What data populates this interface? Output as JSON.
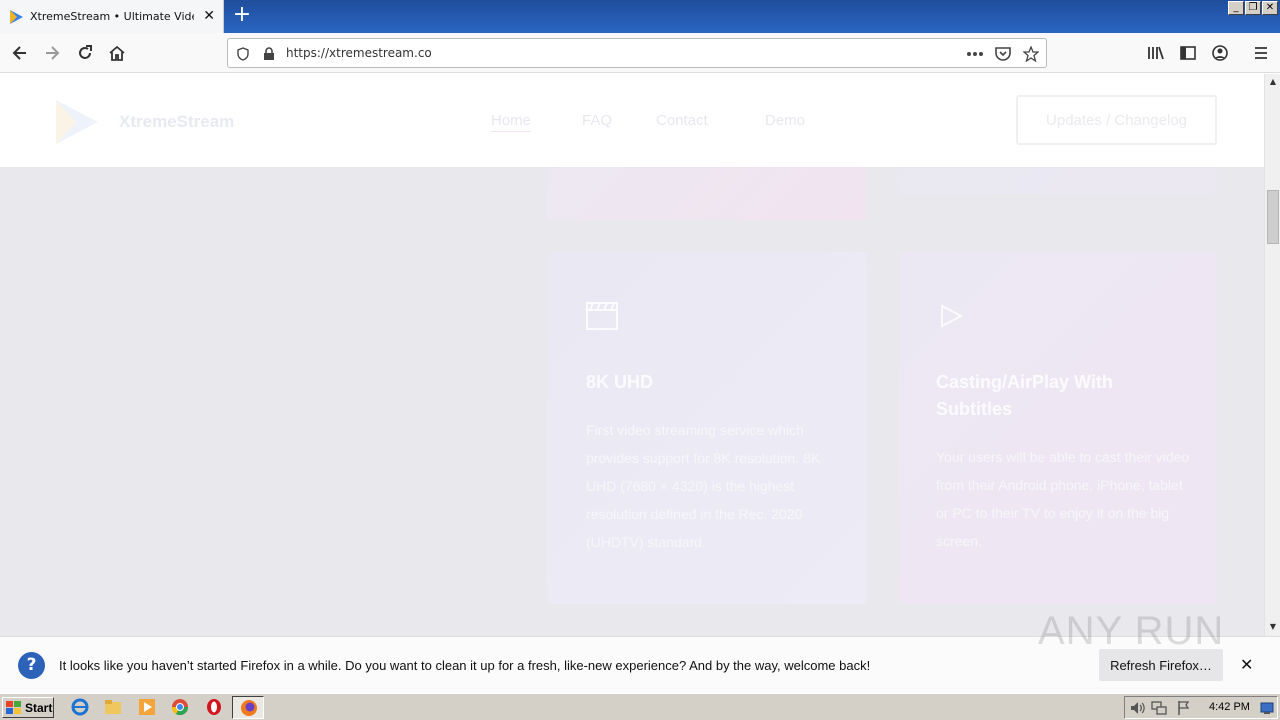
{
  "browser": {
    "tab_title": "XtremeStream • Ultimate Video Str",
    "url": "https://xtremestream.co",
    "window_controls": [
      "minimize",
      "restore",
      "close"
    ]
  },
  "site": {
    "brand": "XtremeStream",
    "nav": [
      {
        "label": "Home",
        "active": true
      },
      {
        "label": "FAQ"
      },
      {
        "label": "Contact"
      },
      {
        "label": "Demo"
      }
    ],
    "changelog_button": "Updates / Changelog",
    "features": [
      {
        "icon": "clapperboard-icon",
        "title": "8K UHD",
        "description": "First video streaming service which provides support for 8K resolution. 8K UHD (7680 × 4320) is the highest resolution defined in the Rec. 2020 (UHDTV) standard."
      },
      {
        "icon": "play-icon",
        "title": "Casting/AirPlay With Subtitles",
        "description": "Your users will be able to cast their video from their Android phone, iPhone, tablet or PC to their TV to enjoy it on the big screen."
      }
    ]
  },
  "notification": {
    "message": "It looks like you haven’t started Firefox in a while. Do you want to clean it up for a fresh, like-new experience? And by the way, welcome back!",
    "button": "Refresh Firefox…",
    "watermark": "ANY RUN"
  },
  "taskbar": {
    "start_label": "Start",
    "clock": "4:42 PM"
  },
  "colors": {
    "titlebar": "#2a66c2",
    "page_bg": "#e9e8ed",
    "notification_icon": "#2c63b8"
  }
}
